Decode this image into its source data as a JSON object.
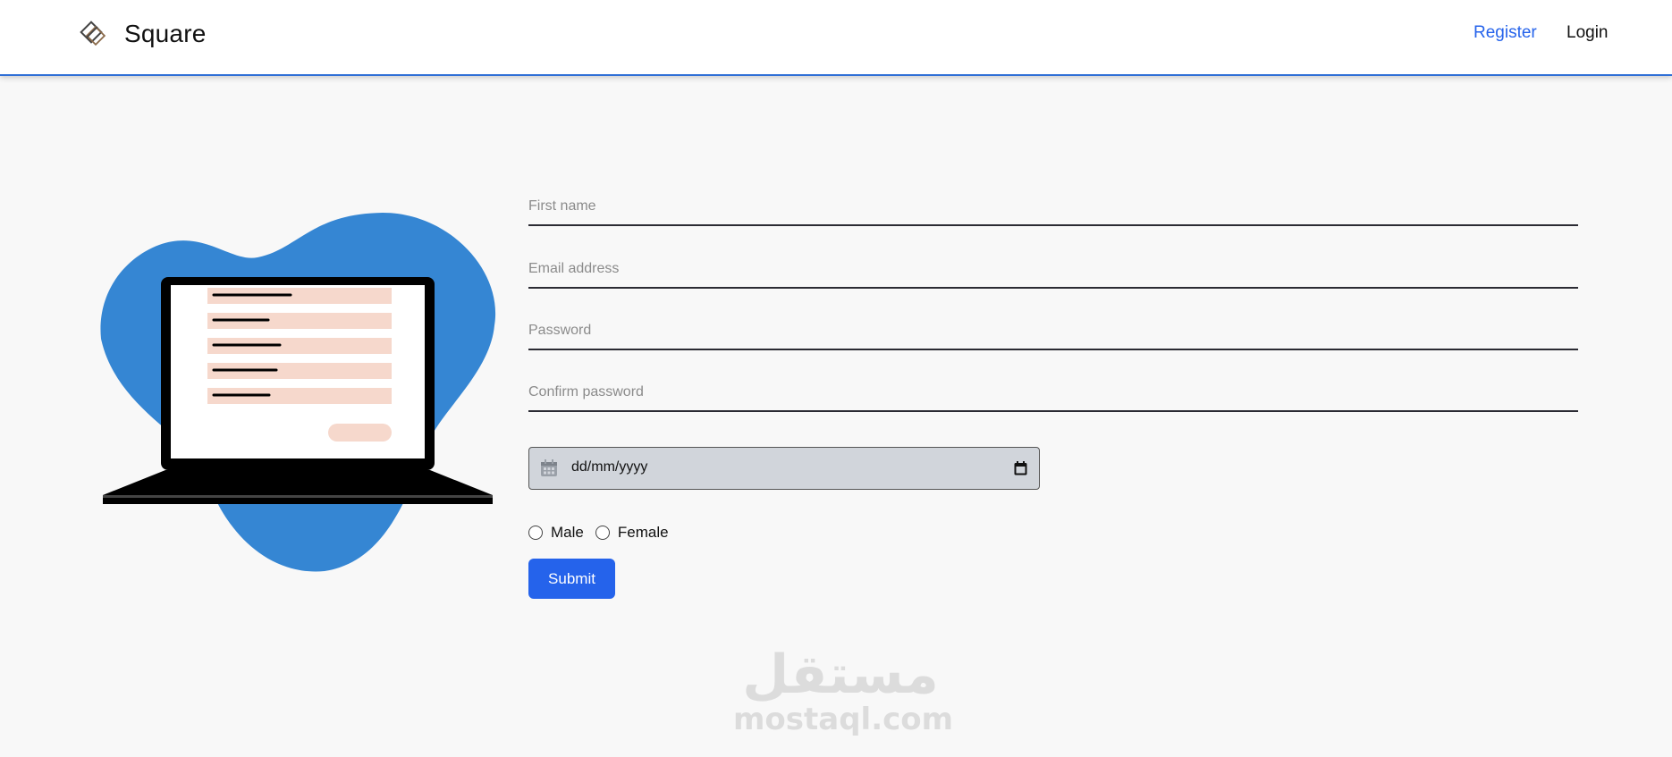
{
  "brand": {
    "name": "Square",
    "icon": "square-logo-icon"
  },
  "nav": {
    "register": "Register",
    "login": "Login"
  },
  "colors": {
    "accent": "#2563eb",
    "blob": "#3586d3",
    "form_line": "#f6d8cc",
    "background": "#f8f8f8"
  },
  "form": {
    "first_name_placeholder": "First name",
    "email_placeholder": "Email address",
    "password_placeholder": "Password",
    "confirm_password_placeholder": "Confirm password",
    "date_value": "dd/mm/yyyy",
    "gender_options": [
      "Male",
      "Female"
    ],
    "submit_label": "Submit"
  },
  "watermark": {
    "arabic": "مستقل",
    "latin": "mostaql.com"
  }
}
